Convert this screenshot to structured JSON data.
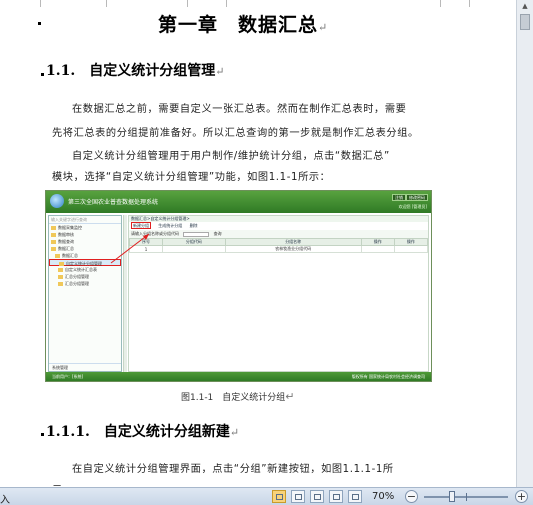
{
  "document": {
    "chapter_title": "第一章　数据汇总",
    "section_title": "1.1.　自定义统计分组管理",
    "paragraph1_line1": "在数据汇总之前，需要自定义一张汇总表。然而在制作汇总表时，需要",
    "paragraph1_line2": "先将汇总表的分组提前准备好。所以汇总查询的第一步就是制作汇总表分组。",
    "paragraph2_line1": "自定义统计分组管理用于用户制作/维护统计分组，点击“数据汇总”",
    "paragraph2_line2": "模块，选择“自定义统计分组管理”功能，如图1.1-1所示：",
    "figure_caption": "图1.1-1　自定义统计分组",
    "subsection_title": "1.1.1.　自定义统计分组新建",
    "paragraph3_line1": "在自定义统计分组管理界面，点击“分组”新建按钮，如图1.1.1-1所",
    "paragraph3_line2": "示。",
    "paragraph_mark": "↵"
  },
  "embedded_app": {
    "title": "第三次全国农业普查数据处理系统",
    "top_buttons": [
      "注销",
      "修改密码"
    ],
    "top_link": "欢迎您  [管理员]",
    "search_placeholder": "输入关键字进行查询",
    "tree_items": [
      "数据采集监控",
      "数据审核",
      "数据查询",
      "数据汇总",
      "数据汇总",
      "自定义统计分组管理",
      "自定义统计汇总表",
      "汇总分组管理",
      "汇总分组管理"
    ],
    "left_footer": "系统管理",
    "breadcrumb": "数据汇总>自定义统计分组管理>",
    "toolbar": [
      "新建分组",
      "生成统计分组",
      "删除"
    ],
    "filter_label": "请输入分组名称或分组代码",
    "filter_button": "查询",
    "table_headers": [
      "序号",
      "分组代码",
      "分组名称",
      "操作",
      "操作"
    ],
    "table_row": [
      "1",
      "",
      "农林牧渔业分组代码",
      "",
      ""
    ],
    "status_left": "当前用户：[系统]",
    "status_right": "版权所有 国家统计局农村社会经济调查司"
  },
  "statusbar": {
    "left_text": "入",
    "zoom_label": "70%",
    "zoom_out": "−",
    "zoom_in": "+",
    "zoom_level": 0.7
  }
}
